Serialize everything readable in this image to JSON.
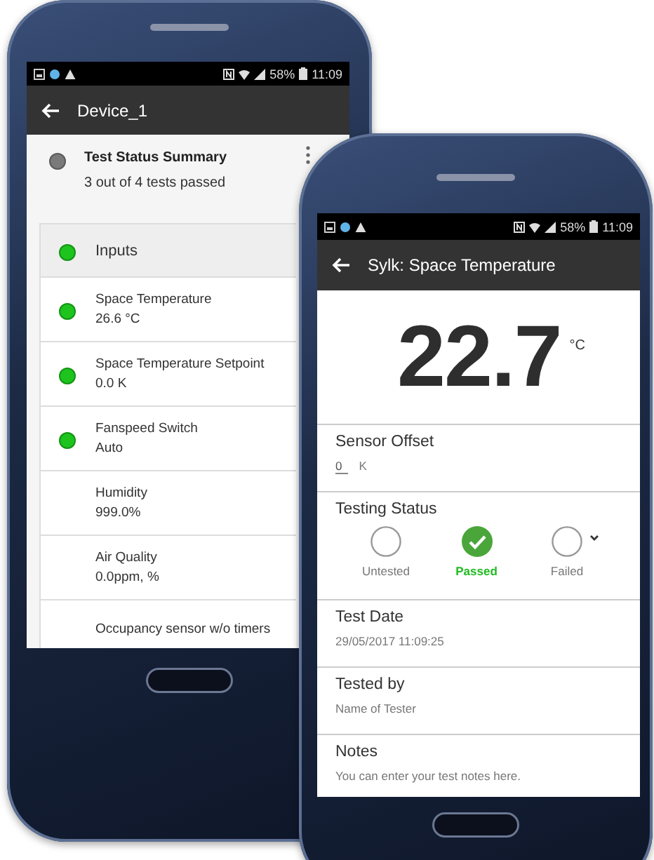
{
  "device_screen": {
    "status_bar": {
      "battery": "58%",
      "time": "11:09"
    },
    "app_bar": {
      "title": "Device_1"
    },
    "summary": {
      "title": "Test Status Summary",
      "text": "3  out of  4  tests passed",
      "color": "#7a7a7a"
    },
    "group": {
      "title": "Inputs",
      "color": "#1dc41d"
    },
    "items": [
      {
        "name": "Space Temperature",
        "value": "26.6 °C",
        "color": "#1dc41d"
      },
      {
        "name": "Space Temperature Setpoint",
        "value": "0.0 K",
        "color": "#1dc41d"
      },
      {
        "name": "Fanspeed Switch",
        "value": "Auto",
        "color": "#1dc41d"
      },
      {
        "name": "Humidity",
        "value": "999.0%"
      },
      {
        "name": "Air Quality",
        "value": "0.0ppm, %"
      },
      {
        "name": "Occupancy sensor w/o timers"
      }
    ]
  },
  "detail_screen": {
    "status_bar": {
      "battery": "58%",
      "time": "11:09"
    },
    "app_bar": {
      "title": "Sylk: Space Temperature"
    },
    "reading": {
      "value": "22.7",
      "unit": "°C"
    },
    "sensor_offset": {
      "label": "Sensor Offset",
      "value": "0",
      "unit": "K"
    },
    "testing_status": {
      "label": "Testing Status",
      "options": [
        {
          "label": "Untested",
          "selected": false
        },
        {
          "label": "Passed",
          "selected": true
        },
        {
          "label": "Failed",
          "selected": false
        }
      ]
    },
    "test_date": {
      "label": "Test Date",
      "value": "29/05/2017 11:09:25"
    },
    "tested_by": {
      "label": "Tested by",
      "placeholder": "Name of Tester"
    },
    "notes": {
      "label": "Notes",
      "placeholder": "You can enter your test notes here."
    }
  }
}
